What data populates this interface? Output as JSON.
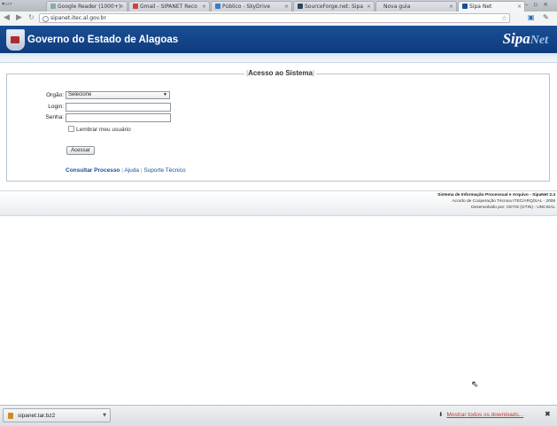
{
  "browser": {
    "tabs": [
      {
        "label": "Google Reader (1000+)",
        "active": false
      },
      {
        "label": "Gmail - SIPANET Reco",
        "active": false
      },
      {
        "label": "Público - SkyDrive",
        "active": false
      },
      {
        "label": "SourceForge.net: Sipa",
        "active": false
      },
      {
        "label": "Nova guia",
        "active": false
      },
      {
        "label": "Sipa Net",
        "active": true
      }
    ],
    "url": "sipanet.itec.al.gov.br"
  },
  "header": {
    "title": "Governo do Estado de Alagoas",
    "logo_main": "Sipa",
    "logo_sub": "Net",
    "brand_color": "#1a4e95"
  },
  "login": {
    "legend": "Acesso ao Sistema",
    "orgao_label": "Orgão:",
    "orgao_selected": "Selecione",
    "login_label": "Login:",
    "login_value": "",
    "senha_label": "Senha:",
    "senha_value": "",
    "remember_label": "Lembrar meu usuário",
    "submit_label": "Acessar",
    "links": {
      "consultar": "Consultar Processo",
      "sep1": "|",
      "ajuda": "Ajuda",
      "sep2": "|",
      "suporte": "Suporte Técnico"
    }
  },
  "footer": {
    "line1": "Sistema de Informação Processual e Arquivo - SipaNet 2.4",
    "line2": "Acordo de Cooperação Técnica ITEC/ARQ/SAL - 2008",
    "line3": "Desenvolvido por: CETIS (GTIN) - UNCISAL"
  },
  "downloads": {
    "file_name": "sipanet.tar.bz2",
    "show_all": "Mostrar todos os downloads..."
  }
}
